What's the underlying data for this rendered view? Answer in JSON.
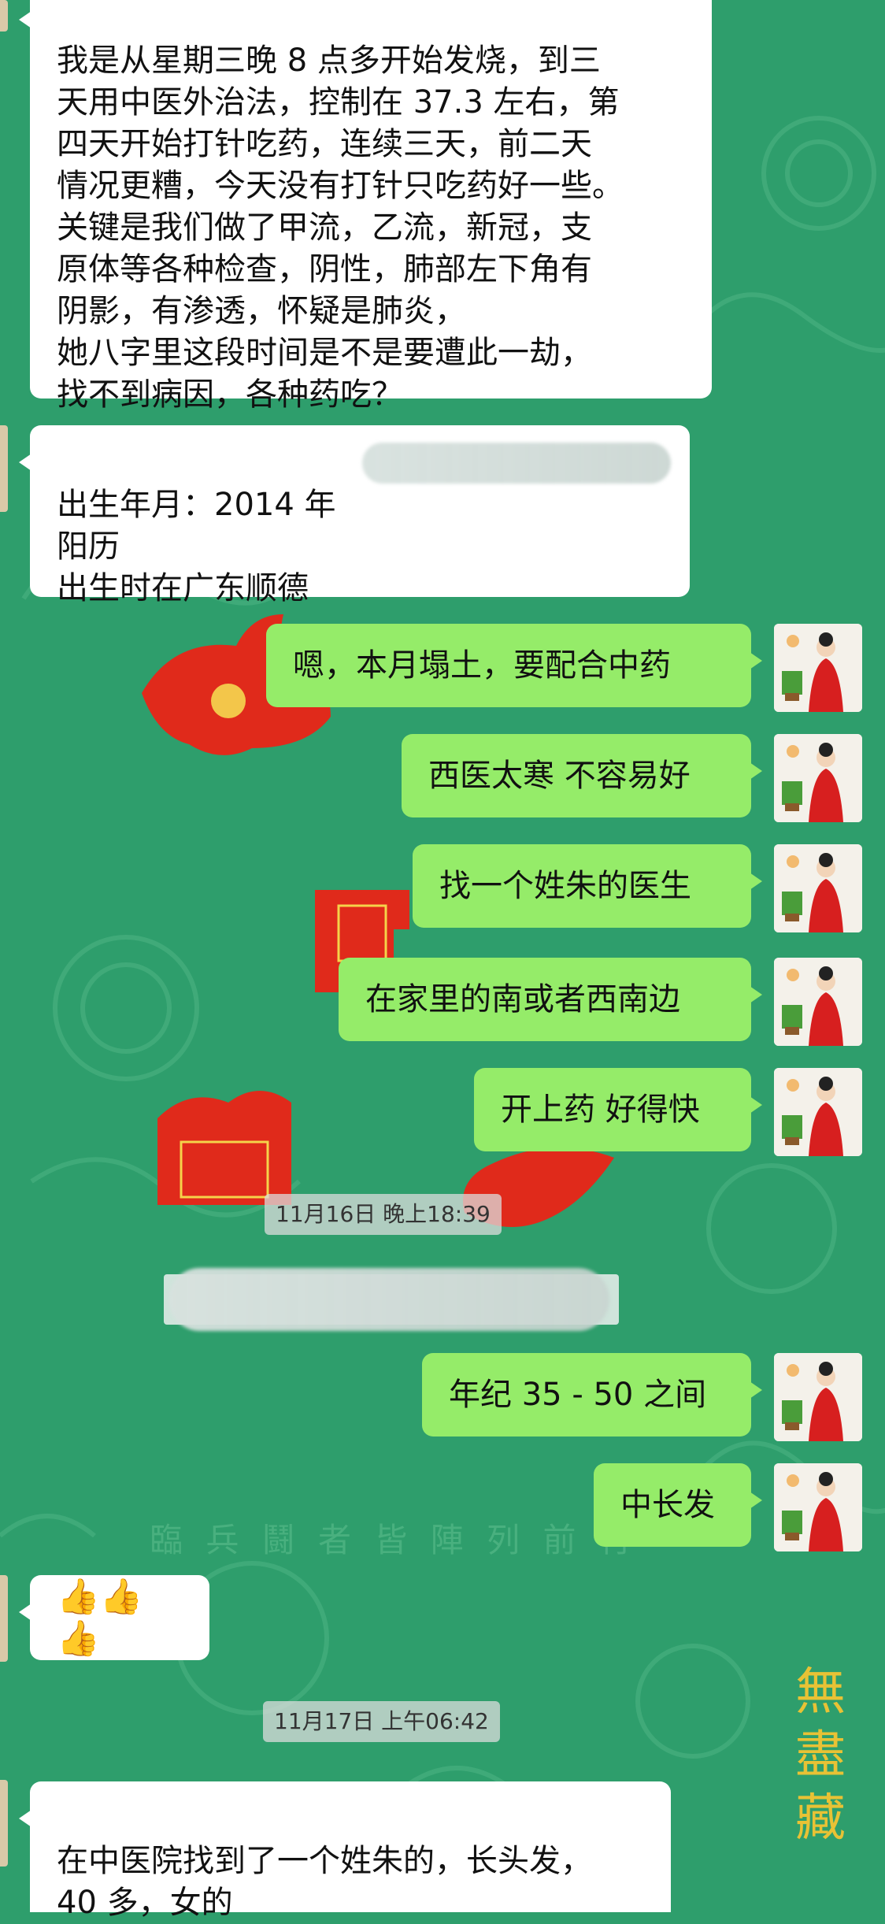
{
  "colors": {
    "chat_background": "#2e9e6c",
    "sent_bubble": "#95ec69",
    "received_bubble": "#ffffff",
    "decor_red": "#e02a1b"
  },
  "background_decor": {
    "poem_line": "臨 兵 鬪 者 皆 陣 列 前 行",
    "seal_text": "無 盡 藏"
  },
  "messages": [
    {
      "side": "received",
      "text": "我是从星期三晚 8 点多开始发烧，到三\n天用中医外治法，控制在 37.3 左右，第\n四天开始打针吃药，连续三天，前二天\n情况更糟，今天没有打针只吃药好一些。\n关键是我们做了甲流，乙流，新冠，支\n原体等各种检查，阴性，肺部左下角有\n阴影，有渗透，怀疑是肺炎，\n她八字里这段时间是不是要遭此一劫，\n找不到病因，各种药吃？"
    },
    {
      "side": "received",
      "text": "出生年月：2014 年\n阳历\n出生时在广东顺德"
    },
    {
      "side": "sent",
      "text": "嗯，本月塌土，要配合中药"
    },
    {
      "side": "sent",
      "text": "西医太寒 不容易好"
    },
    {
      "side": "sent",
      "text": "找一个姓朱的医生"
    },
    {
      "side": "sent",
      "text": "在家里的南或者西南边"
    },
    {
      "side": "sent",
      "text": "开上药 好得快"
    },
    {
      "side": "timestamp",
      "text": "11月16日 晚上18:39"
    },
    {
      "side": "sent",
      "text": "年纪 35 - 50 之间"
    },
    {
      "side": "sent",
      "text": "中长发"
    },
    {
      "side": "received",
      "text": "👍👍👍"
    },
    {
      "side": "timestamp",
      "text": "11月17日 上午06:42"
    },
    {
      "side": "received",
      "text": "在中医院找到了一个姓朱的，长头发，\n40 多，女的"
    }
  ],
  "icons": {
    "sender_avatar": "woman-in-red-robe-avatar-icon",
    "received_avatar": "cropped-avatar-icon"
  }
}
